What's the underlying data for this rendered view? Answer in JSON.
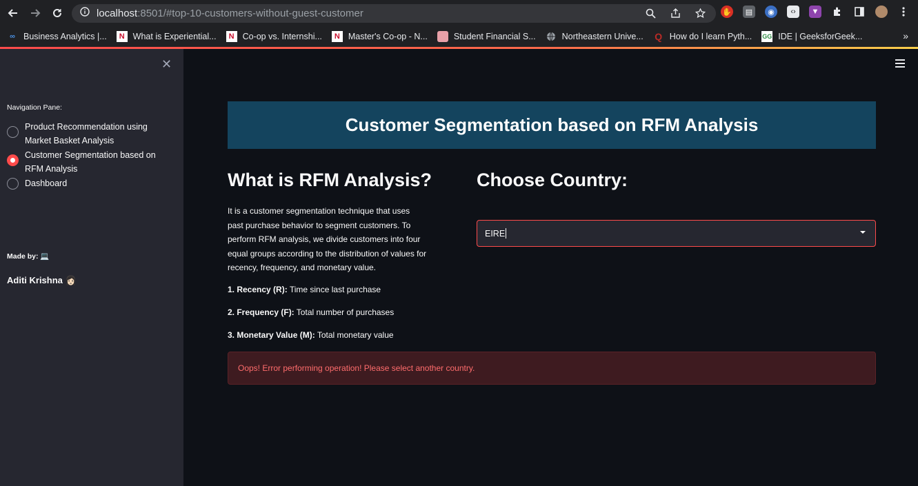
{
  "browser": {
    "url_host": "localhost",
    "url_rest": ":8501/#top-10-customers-without-guest-customer",
    "bookmarks": [
      {
        "label": "Business Analytics |...",
        "icon": "infinity-icon",
        "color": "#1a73e8"
      },
      {
        "label": "What is Experiential...",
        "icon": "northeastern-icon",
        "color": "#c8102e"
      },
      {
        "label": "Co-op vs. Internshi...",
        "icon": "northeastern-icon",
        "color": "#c8102e"
      },
      {
        "label": "Master's Co-op - N...",
        "icon": "northeastern-icon",
        "color": "#c8102e"
      },
      {
        "label": "Student Financial S...",
        "icon": "seal-icon",
        "color": "#e8a0a8"
      },
      {
        "label": "Northeastern Unive...",
        "icon": "globe-icon",
        "color": "#9aa0a6"
      },
      {
        "label": "How do I learn Pyth...",
        "icon": "quora-icon",
        "color": "#b92b27"
      },
      {
        "label": "IDE | GeeksforGeek...",
        "icon": "gfg-icon",
        "color": "#2f8d46"
      }
    ]
  },
  "sidebar": {
    "nav_label": "Navigation Pane:",
    "options": [
      {
        "label": "Product Recommendation using Market Basket Analysis",
        "selected": false
      },
      {
        "label": "Customer Segmentation based on RFM Analysis",
        "selected": true
      },
      {
        "label": "Dashboard",
        "selected": false
      }
    ],
    "made_by": "Made by: 💻",
    "author": "Aditi Krishna 👩🏻"
  },
  "main": {
    "banner_title": "Customer Segmentation based on RFM Analysis",
    "rfm_heading": "What is RFM Analysis?",
    "rfm_description": "It is a customer segmentation technique that uses past purchase behavior to segment customers. To perform RFM analysis, we divide customers into four equal groups according to the distribution of values for recency, frequency, and monetary value.",
    "metrics": [
      {
        "term": "1. Recency (R):",
        "desc": " Time since last purchase"
      },
      {
        "term": "2. Frequency (F):",
        "desc": " Total number of purchases"
      },
      {
        "term": "3. Monetary Value (M):",
        "desc": " Total monetary value"
      }
    ],
    "country_heading": "Choose Country:",
    "country_value": "EIRE",
    "error_message": "Oops! Error performing operation! Please select another country."
  },
  "colors": {
    "accent": "#ff4b4b",
    "banner_bg": "#14445e",
    "sidebar_bg": "#262730",
    "main_bg": "#0e1117",
    "error_bg": "#3e1b20",
    "error_text": "#ff6c6c"
  }
}
